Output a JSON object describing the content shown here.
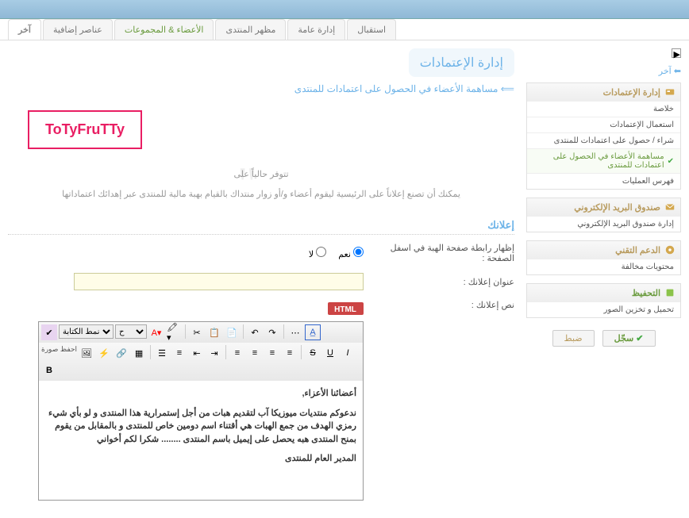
{
  "tabs": [
    {
      "label": "استقبال"
    },
    {
      "label": "إدارة عامة"
    },
    {
      "label": "مظهر المنتدى"
    },
    {
      "label": "الأعضاء & المجموعات",
      "green": true
    },
    {
      "label": "عناصر إضافية"
    },
    {
      "label": "آخر",
      "active": true
    }
  ],
  "akhir_label": "⬅ آخر",
  "panels": {
    "credits": {
      "title": "إدارة الإعتمادات",
      "items": [
        {
          "label": "خلاصة"
        },
        {
          "label": "استعمال الإعتمادات"
        },
        {
          "label": "شراء / حصول على اعتمادات للمنتدى"
        },
        {
          "label": "مساهمة الأعضاء في الحصول على اعتمادات للمنتدى",
          "active": true
        },
        {
          "label": "فهرس العمليات"
        }
      ]
    },
    "mail": {
      "title": "صندوق البريد الإلكتروني",
      "items": [
        {
          "label": "إدارة صندوق البريد الإلكتروني"
        }
      ]
    },
    "support": {
      "title": "الدعم التقني",
      "items": [
        {
          "label": "محتويات مخالفة"
        }
      ]
    },
    "save_panel": {
      "title": "التحفيظ",
      "items": [
        {
          "label": "تحميل و تخزين الصور"
        }
      ]
    }
  },
  "buttons": {
    "save": "سجّل",
    "reset": "ضبط"
  },
  "page_title": "إدارة الإعتمادات",
  "page_subtitle": "مساهمة الأعضاء في الحصول على اعتمادات للمنتدى",
  "desc_line1": "تتوفر حالياً على",
  "desc_line2": "يمكنك أن تصنع إعلاناً على الرئيسية ليقوم أعضاء و/أو زوار منتداك بالقيام بهبة مالية للمنتدى عبر إهدائك اعتماداتها",
  "section_title": "إعلانك",
  "form": {
    "show_footer_label": "إظهار رابطة صفحة الهبة في اسفل الصفحة :",
    "yes": "نعم",
    "no": "لا",
    "ad_title_label": "عنوان إعلانك :",
    "ad_text_label": "نص إعلانك :",
    "style_select": "نمط الكتابة",
    "upload_label": "احفظ صورة"
  },
  "editor_content": {
    "p1": "أعضائنا الأعزاء,",
    "p2": "ندعوكم منتديات ميوزيكا آب لتقديم هبات من أجل إستمرارية هذا المنتدى و لو بأي شيء رمزي الهدف من جمع الهبات هي أقتناء اسم دومين خاص للمنتدى و بالمقابل من يقوم بمنح المنتدى هبه يحصل على إيميل باسم المنتدى ........ شكرا لكم أخواني",
    "p3": "المدير العام للمنتدى"
  },
  "watermark": "ToTyFruTTy"
}
